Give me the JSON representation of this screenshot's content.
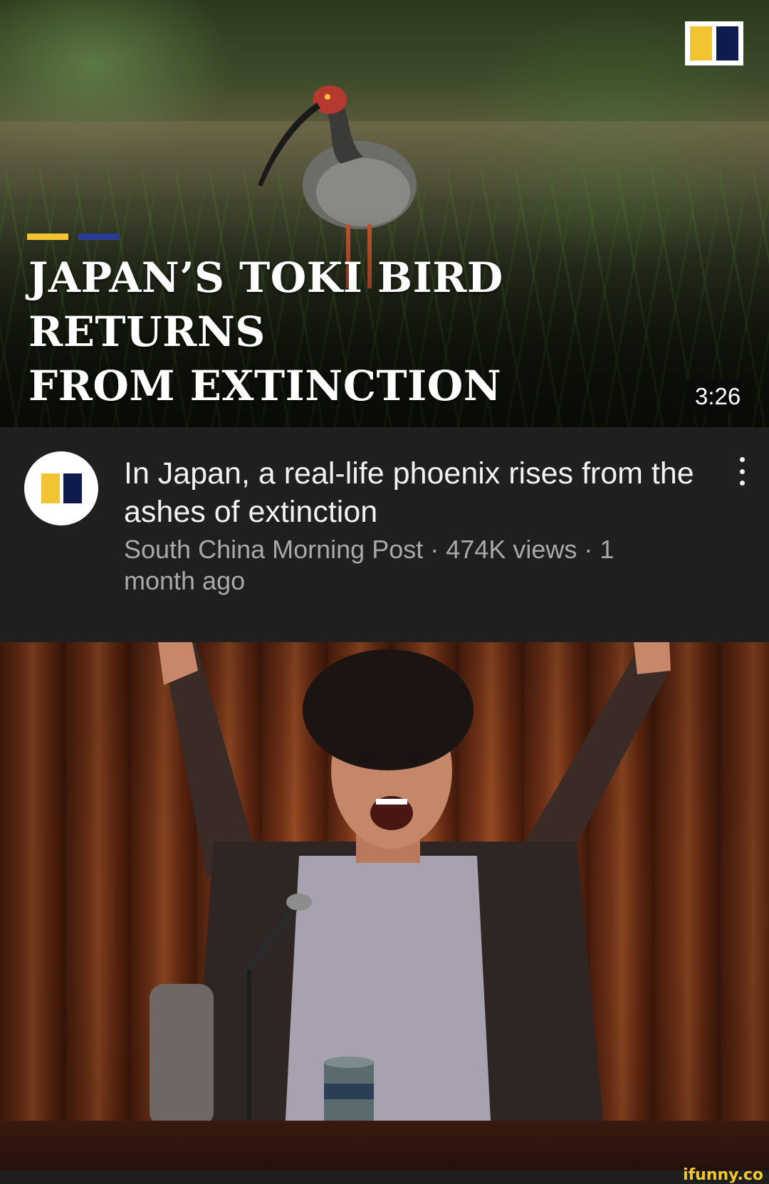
{
  "thumbnail": {
    "headline_line1": "JAPAN’S TOKI BIRD RETURNS",
    "headline_line2": "FROM EXTINCTION",
    "duration": "3:26",
    "brand_icon": "scmp-logo-icon"
  },
  "video": {
    "title": "In Japan, a real-life phoenix rises from the ashes of extinction",
    "channel": "South China Morning Post",
    "views": "474K views",
    "age": "1 month ago",
    "meta_separator": " · ",
    "menu_icon": "more-vert-icon"
  },
  "footer": {
    "watermark": "ifunny.co"
  },
  "colors": {
    "brand_yellow": "#f3c431",
    "brand_navy": "#0f1b4d",
    "background": "#1f1f1f",
    "title_text": "#f1f1f1",
    "meta_text": "#a9a9a9",
    "watermark": "#f6c72c"
  }
}
